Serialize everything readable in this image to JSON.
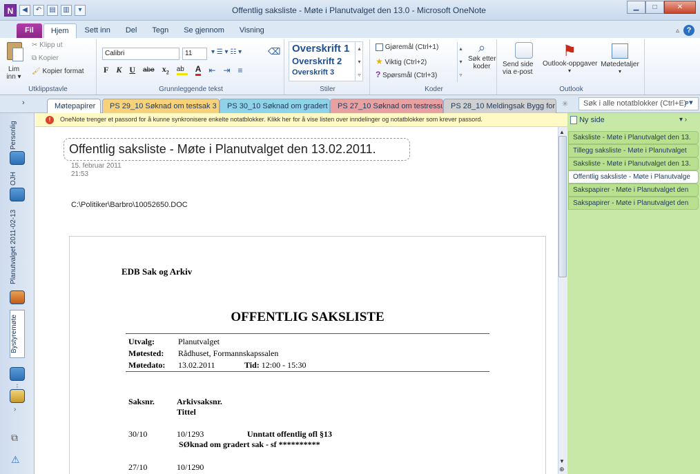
{
  "window": {
    "title": "Offentlig saksliste - Møte i Planutvalget den 13.0  -  Microsoft OneNote",
    "app_icon": "N"
  },
  "ribbon_tabs": [
    "Fil",
    "Hjem",
    "Sett inn",
    "Del",
    "Tegn",
    "Se gjennom",
    "Visning"
  ],
  "clipboard": {
    "cut": "Klipp ut",
    "copy": "Kopier",
    "paste_line1": "Lim",
    "paste_line2": "inn",
    "format_painter": "Kopier format",
    "group_label": "Utklippstavle"
  },
  "font": {
    "family": "Calibri",
    "size": "11",
    "group_label": "Grunnleggende tekst"
  },
  "styles": {
    "h1": "Overskrift 1",
    "h2": "Overskrift 2",
    "h3": "Overskrift 3",
    "group_label": "Stiler"
  },
  "tags": {
    "todo": "Gjøremål (Ctrl+1)",
    "important": "Viktig (Ctrl+2)",
    "question": "Spørsmål (Ctrl+3)",
    "find_line1": "Søk etter",
    "find_line2": "koder",
    "group_label": "Koder"
  },
  "outlook": {
    "email_line1": "Send side",
    "email_line2": "via e-post",
    "tasks": "Outlook-oppgaver",
    "meeting": "Møtedetaljer",
    "group_label": "Outlook"
  },
  "section_tabs": [
    {
      "label": "Møtepapirer",
      "color": "#ffffff"
    },
    {
      "label": "PS 29_10 Søknad om testsak 3 SF",
      "color": "#f7d27a"
    },
    {
      "label": "PS 30_10 Søknad om gradert sak",
      "color": "#8fd3e8"
    },
    {
      "label": "PS 27_10 Søknad om testressur...",
      "color": "#e8a0a0"
    },
    {
      "label": "PS 28_10 Meldingsak Bygg for ...",
      "color": "#d0d0d0"
    }
  ],
  "search": {
    "placeholder": "Søk i alle notatblokker (Ctrl+E)"
  },
  "notebooks": [
    "Personlig",
    "OJH",
    "Planutvalget 2011-02-13",
    "Bystyremøte"
  ],
  "notice": "OneNote trenger et passord for å kunne synkronisere enkelte notatblokker. Klikk her for å vise listen over inndelinger og notatblokker som krever passord.",
  "page": {
    "title": "Offentlig saksliste - Møte i Planutvalget den 13.02.2011.",
    "date": "15. februar 2011",
    "time": "21:53",
    "path": "C:\\Politiker\\Barbro\\10052650.DOC"
  },
  "doc": {
    "org": "EDB Sak og Arkiv",
    "heading": "OFFENTLIG SAKSLISTE",
    "utvalg_label": "Utvalg:",
    "utvalg_value": "Planutvalget",
    "motested_label": "Møtested:",
    "motested_value": "Rådhuset, Formannskapssalen",
    "motedato_label": "Møtedato:",
    "motedato_value": "13.02.2011",
    "tid_label": "Tid:",
    "tid_value": "12:00 - 15:30",
    "col_saksnr": "Saksnr.",
    "col_arkiv": "Arkivsaksnr.",
    "col_tittel": "Tittel",
    "rows": [
      {
        "saksnr": "30/10",
        "arkiv": "10/1293",
        "flag": "Unntatt offentlig ofl §13",
        "tittel": "SØknad om gradert sak - sf **********"
      },
      {
        "saksnr": "27/10",
        "arkiv": "10/1290",
        "flag": "",
        "tittel": ""
      }
    ]
  },
  "pages_pane": {
    "new_page": "Ny side",
    "items": [
      "Saksliste - Møte i Planutvalget den 13.",
      "Tillegg saksliste - Møte i Planutvalget",
      "Saksliste - Møte i Planutvalget den 13.",
      "Offentlig saksliste - Møte i Planutvalge",
      "Sakspapirer - Møte i Planutvalget den",
      "Sakspapirer - Møte i Planutvalget den"
    ],
    "selected_index": 3
  },
  "colors": {
    "file_tab": "#a0329a",
    "pages_bg": "#c7e8a7",
    "notice_bg": "#fff9c6"
  }
}
